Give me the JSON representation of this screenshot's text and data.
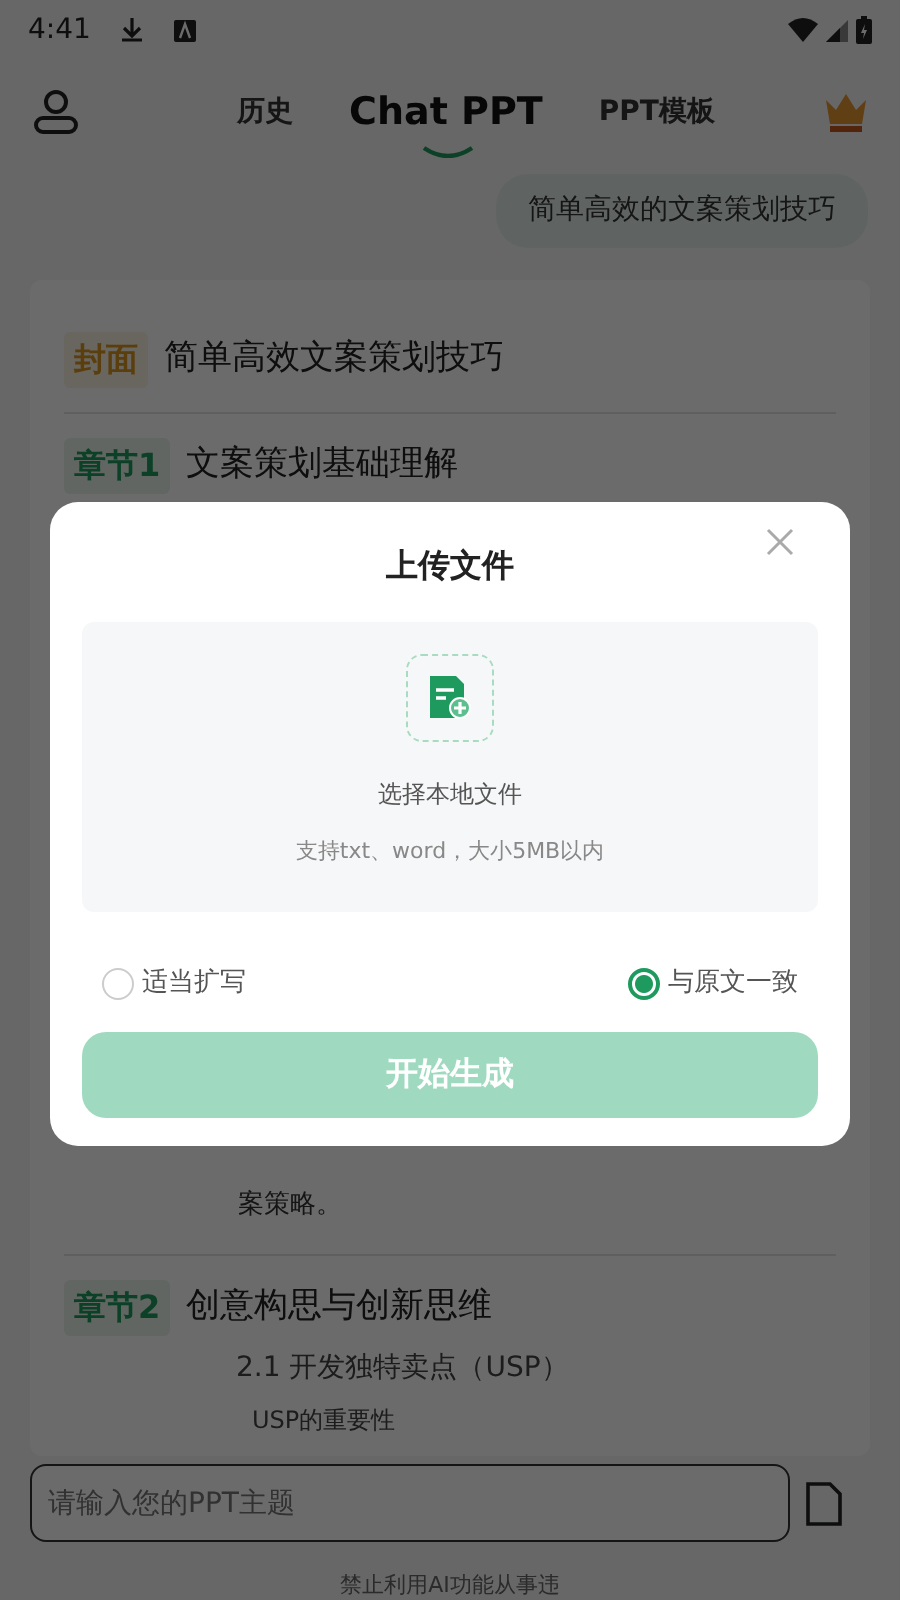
{
  "status_bar": {
    "time": "4:41"
  },
  "header": {
    "tabs": [
      {
        "label": "历史",
        "selected": false
      },
      {
        "label": "Chat PPT",
        "selected": true
      },
      {
        "label": "PPT模板",
        "selected": false
      }
    ]
  },
  "chat": {
    "user_message": "简单高效的文案策划技巧",
    "outline": [
      {
        "kind": "cover",
        "tag": "封面",
        "title": "简单高效文案策划技巧"
      },
      {
        "kind": "chapter",
        "tag": "章节1",
        "title": "文案策划基础理解",
        "paragraph": "案策略。"
      },
      {
        "kind": "chapter",
        "tag": "章节2",
        "title": "创意构思与创新思维",
        "subsection": "2.1 开发独特卖点（USP）",
        "point": "USP的重要性"
      }
    ]
  },
  "input": {
    "placeholder": "请输入您的PPT主题"
  },
  "footer_note": "禁止利用AI功能从事违",
  "dialog": {
    "title": "上传文件",
    "upload_label": "选择本地文件",
    "upload_hint": "支持txt、word，大小5MB以内",
    "options": [
      {
        "label": "适当扩写",
        "selected": false
      },
      {
        "label": "与原文一致",
        "selected": true
      }
    ],
    "button": {
      "label": "开始生成",
      "disabled": true
    }
  }
}
